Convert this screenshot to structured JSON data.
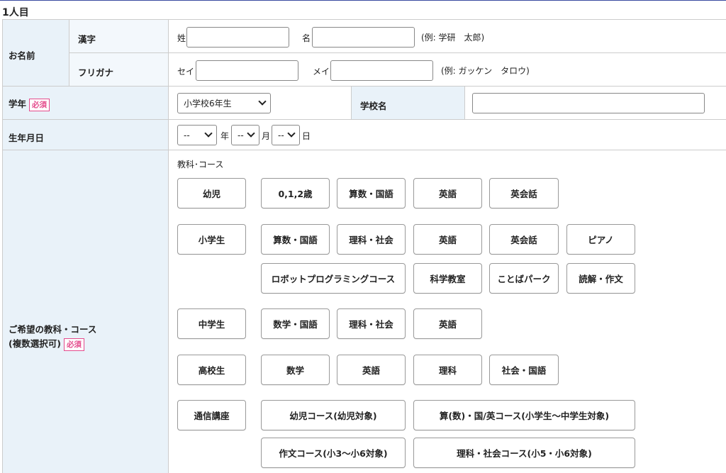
{
  "section_title": "1人目",
  "name": {
    "label": "お名前",
    "kanji_label": "漢字",
    "furigana_label": "フリガナ",
    "sei_label": "姓",
    "mei_label": "名",
    "kanji_example": "(例: 学研　太郎)",
    "sei_kana_label": "セイ",
    "mei_kana_label": "メイ",
    "kana_example": "(例: ガッケン　タロウ)",
    "sei_value": "",
    "mei_value": "",
    "sei_kana_value": "",
    "mei_kana_value": ""
  },
  "grade": {
    "label": "学年",
    "required": "必須",
    "selected": "小学校6年生",
    "school_label": "学校名",
    "school_value": ""
  },
  "birth": {
    "label": "生年月日",
    "year_selected": "--",
    "month_selected": "--",
    "day_selected": "--",
    "year_unit": "年",
    "month_unit": "月",
    "day_unit": "日"
  },
  "courses": {
    "label": "ご希望の教科・コース",
    "sublabel": "(複数選択可)",
    "required": "必須",
    "caption": "教科･コース",
    "groups": [
      {
        "name": "幼児",
        "items": [
          "0,1,2歳",
          "算数・国語",
          "英語",
          "英会話"
        ]
      },
      {
        "name": "小学生",
        "items": [
          "算数・国語",
          "理科・社会",
          "英語",
          "英会話",
          "ピアノ",
          "ロボットプログラミングコース",
          "科学教室",
          "ことばパーク",
          "読解・作文"
        ]
      },
      {
        "name": "中学生",
        "items": [
          "数学・国語",
          "理科・社会",
          "英語"
        ]
      },
      {
        "name": "高校生",
        "items": [
          "数学",
          "英語",
          "理科",
          "社会・国語"
        ]
      },
      {
        "name": "通信講座",
        "items": [
          "幼児コース(幼児対象)",
          "算(数)・国/英コース(小学生～中学生対象)",
          "作文コース(小3～小6対象)",
          "理科・社会コース(小5・小6対象)"
        ]
      }
    ]
  }
}
